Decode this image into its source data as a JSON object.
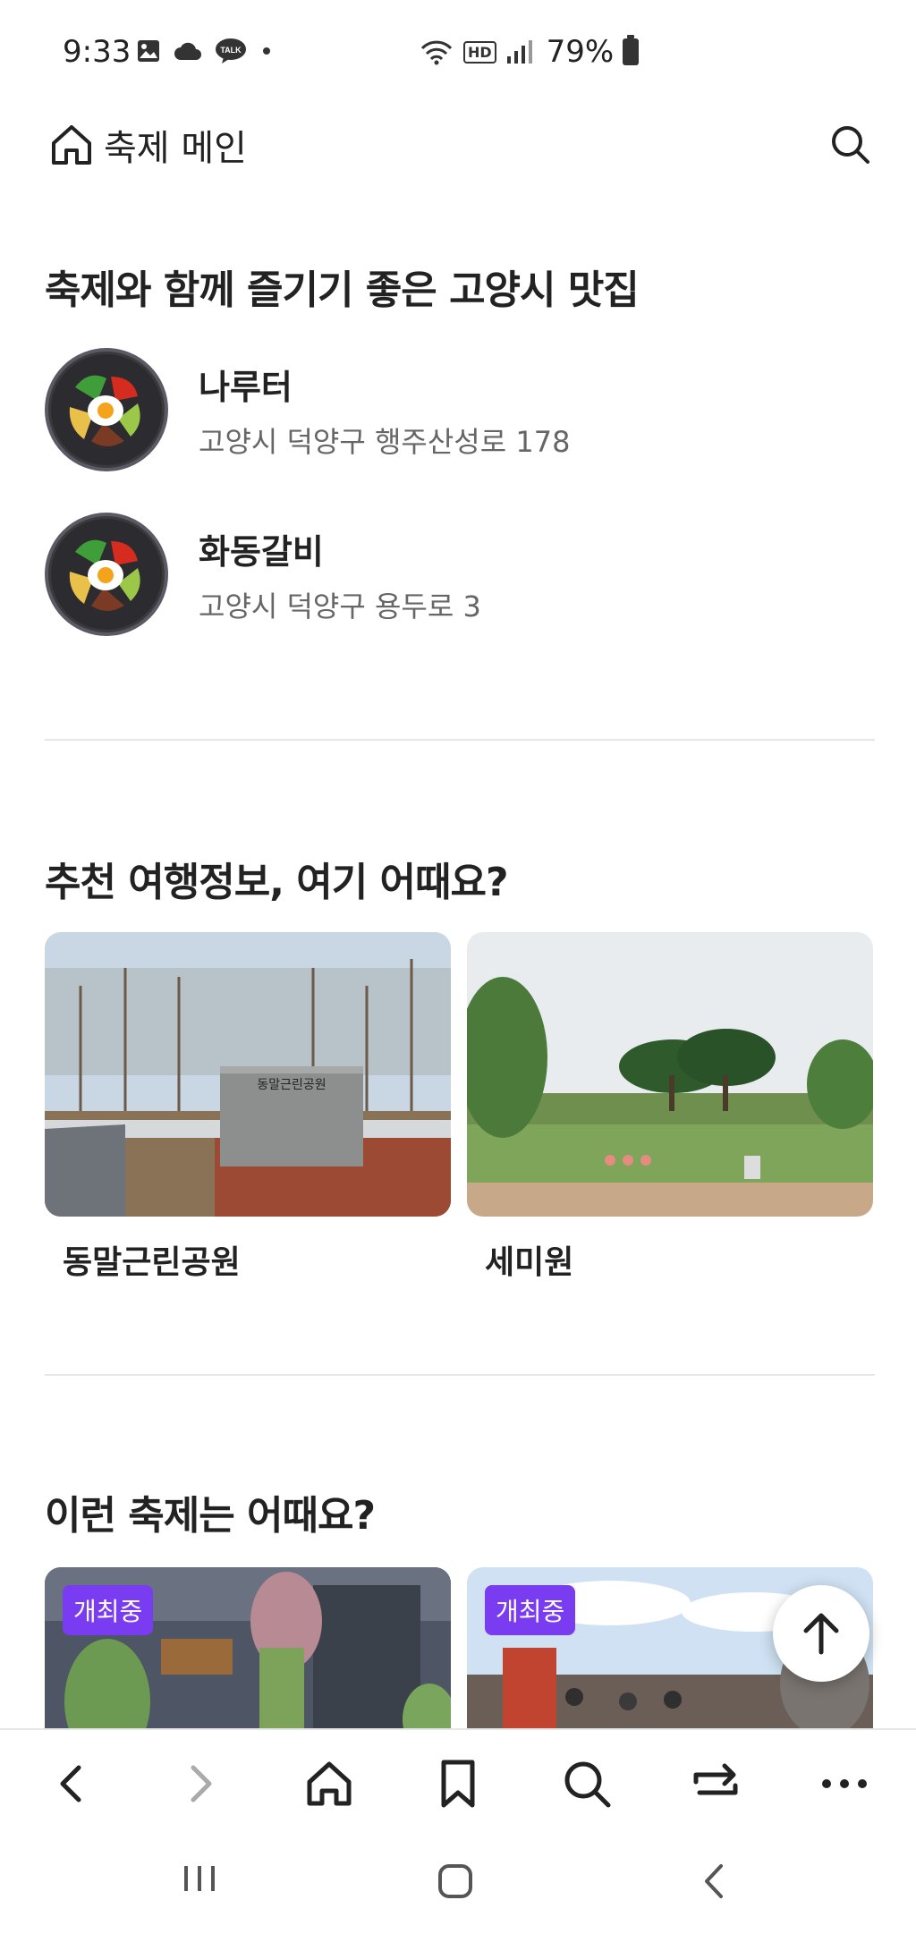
{
  "status": {
    "time": "9:33",
    "battery": "79%",
    "hd": "HD"
  },
  "nav": {
    "title": "축제 메인"
  },
  "restaurants": {
    "title": "축제와 함께 즐기기 좋은 고양시 맛집",
    "items": [
      {
        "name": "나루터",
        "address": "고양시 덕양구 행주산성로 178"
      },
      {
        "name": "화동갈비",
        "address": "고양시 덕양구 용두로 3"
      }
    ]
  },
  "travel": {
    "title": "추천 여행정보, 여기 어때요?",
    "cards": [
      {
        "label": "동말근린공원"
      },
      {
        "label": "세미원"
      }
    ]
  },
  "festivals": {
    "title": "이런 축제는 어때요?",
    "cards": [
      {
        "badge": "개최중"
      },
      {
        "badge": "개최중"
      }
    ]
  },
  "colors": {
    "accent": "#7a3cf0",
    "text": "#222222",
    "subtext": "#666666",
    "divider": "#e6e6e6"
  }
}
